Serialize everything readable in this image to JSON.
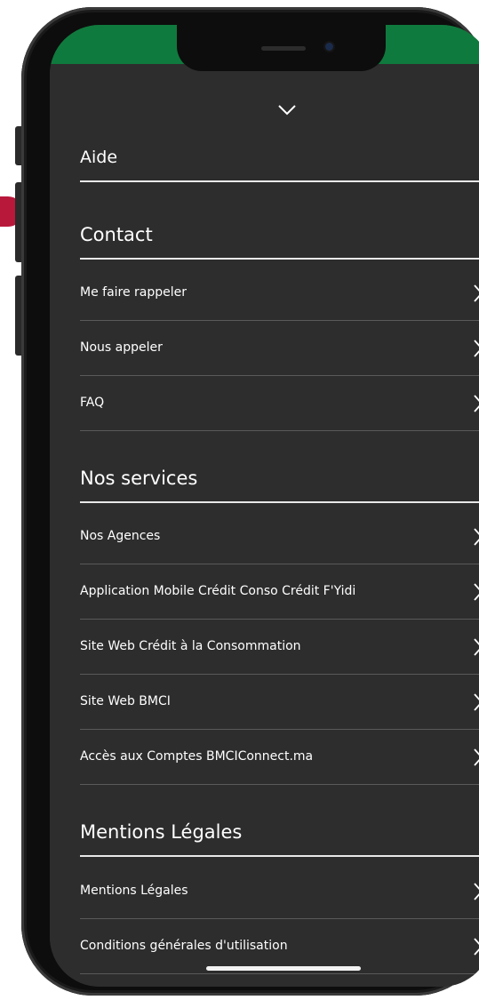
{
  "menu": {
    "collapse_icon": "chevron-down-icon",
    "item_icon": "chevron-right-icon",
    "sections": [
      {
        "title": "Aide",
        "items": []
      },
      {
        "title": "Contact",
        "items": [
          {
            "label": "Me faire rappeler"
          },
          {
            "label": "Nous appeler"
          },
          {
            "label": "FAQ"
          }
        ]
      },
      {
        "title": "Nos services",
        "items": [
          {
            "label": "Nos Agences"
          },
          {
            "label": "Application Mobile Crédit Conso Crédit F'Yidi"
          },
          {
            "label": "Site Web Crédit à la Consommation"
          },
          {
            "label": "Site Web BMCI"
          },
          {
            "label": "Accès aux Comptes BMCIConnect.ma"
          }
        ]
      },
      {
        "title": "Mentions Légales",
        "items": [
          {
            "label": "Mentions Légales"
          },
          {
            "label": "Conditions générales d'utilisation"
          }
        ]
      }
    ]
  },
  "colors": {
    "background": "#2d2d2d",
    "header_bar": "#0f7a3d",
    "text": "#ffffff",
    "divider": "#5a5a5a",
    "accent_dot": "#b8183a"
  }
}
